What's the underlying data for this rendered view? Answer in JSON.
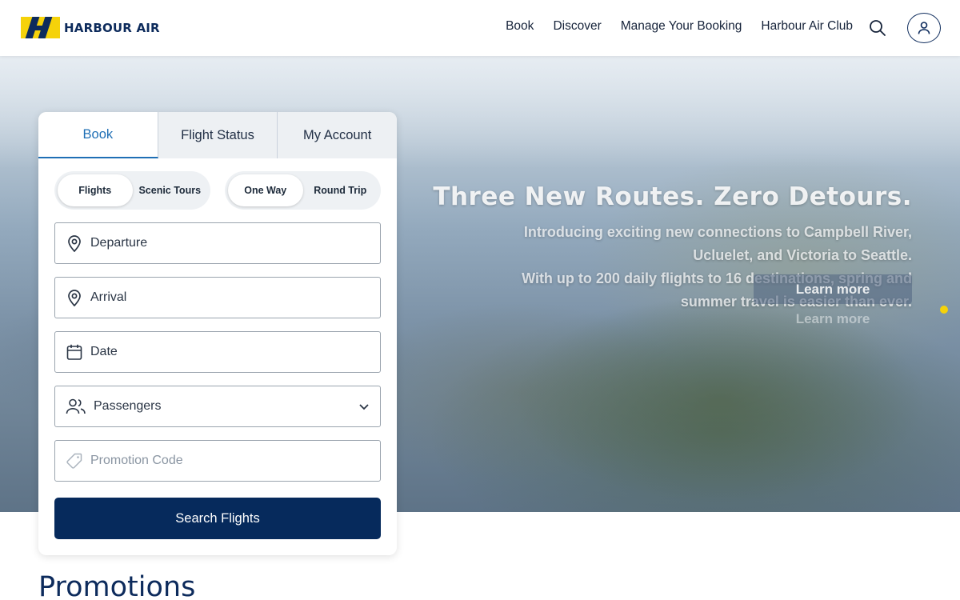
{
  "brand": {
    "name": "HARBOUR AIR",
    "colors": {
      "navy": "#0d2b5c",
      "yellow": "#f5d20a",
      "accent_blue": "#1f6fb5"
    }
  },
  "nav": {
    "items": [
      "Book",
      "Discover",
      "Manage Your Booking",
      "Harbour Air Club"
    ]
  },
  "icons": {
    "search": "search-icon",
    "account": "user-icon"
  },
  "hero": {
    "title": "Three New Routes. Zero Detours.",
    "subtitle_lines": [
      "Introducing exciting new connections to Campbell River,",
      "Ucluelet, and Victoria to Seattle.",
      "With up to 200 daily flights to 16 destinations, spring and",
      "summer travel is easier than ever."
    ],
    "cta_label": "Learn more"
  },
  "booking": {
    "tabs": [
      "Book",
      "Flight Status",
      "My Account"
    ],
    "active_tab": "Book",
    "trip_kind": {
      "options": [
        "Flights",
        "Scenic Tours"
      ],
      "selected": "Flights"
    },
    "trip_type": {
      "options": [
        "One Way",
        "Round Trip"
      ],
      "selected": "One Way"
    },
    "fields": {
      "departure": "Departure",
      "arrival": "Arrival",
      "date": "Date",
      "passengers": "Passengers",
      "promo": "Promotion Code"
    },
    "submit_label": "Search Flights"
  },
  "promotions": {
    "heading": "Promotions"
  }
}
